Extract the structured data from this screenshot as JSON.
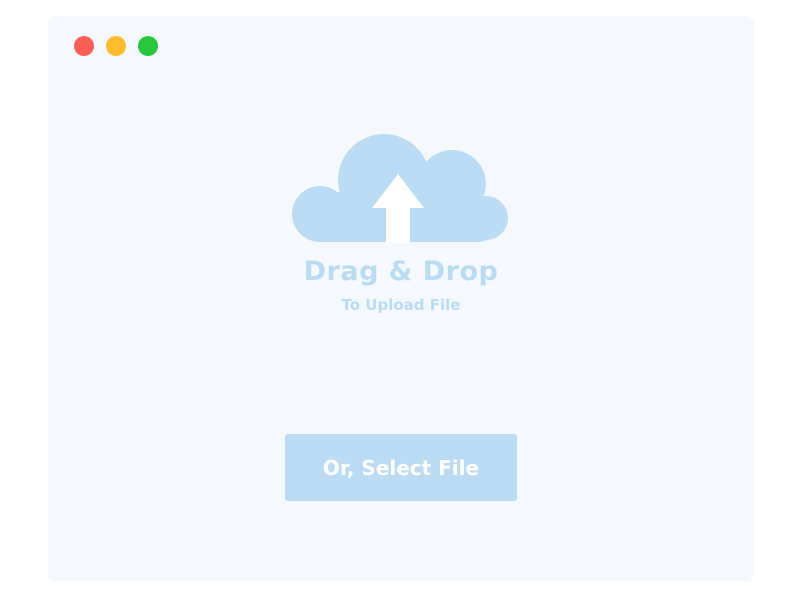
{
  "window": {
    "controls": [
      "close",
      "minimize",
      "zoom"
    ]
  },
  "upload": {
    "icon": "cloud-upload-icon",
    "title": "Drag & Drop",
    "subtitle": "To Upload File",
    "button_label": "Or, Select File"
  },
  "colors": {
    "background": "#f5f9fe",
    "accent": "#bbdcf4",
    "close": "#fd5f57",
    "minimize": "#fdbc2d",
    "zoom": "#27c840"
  }
}
